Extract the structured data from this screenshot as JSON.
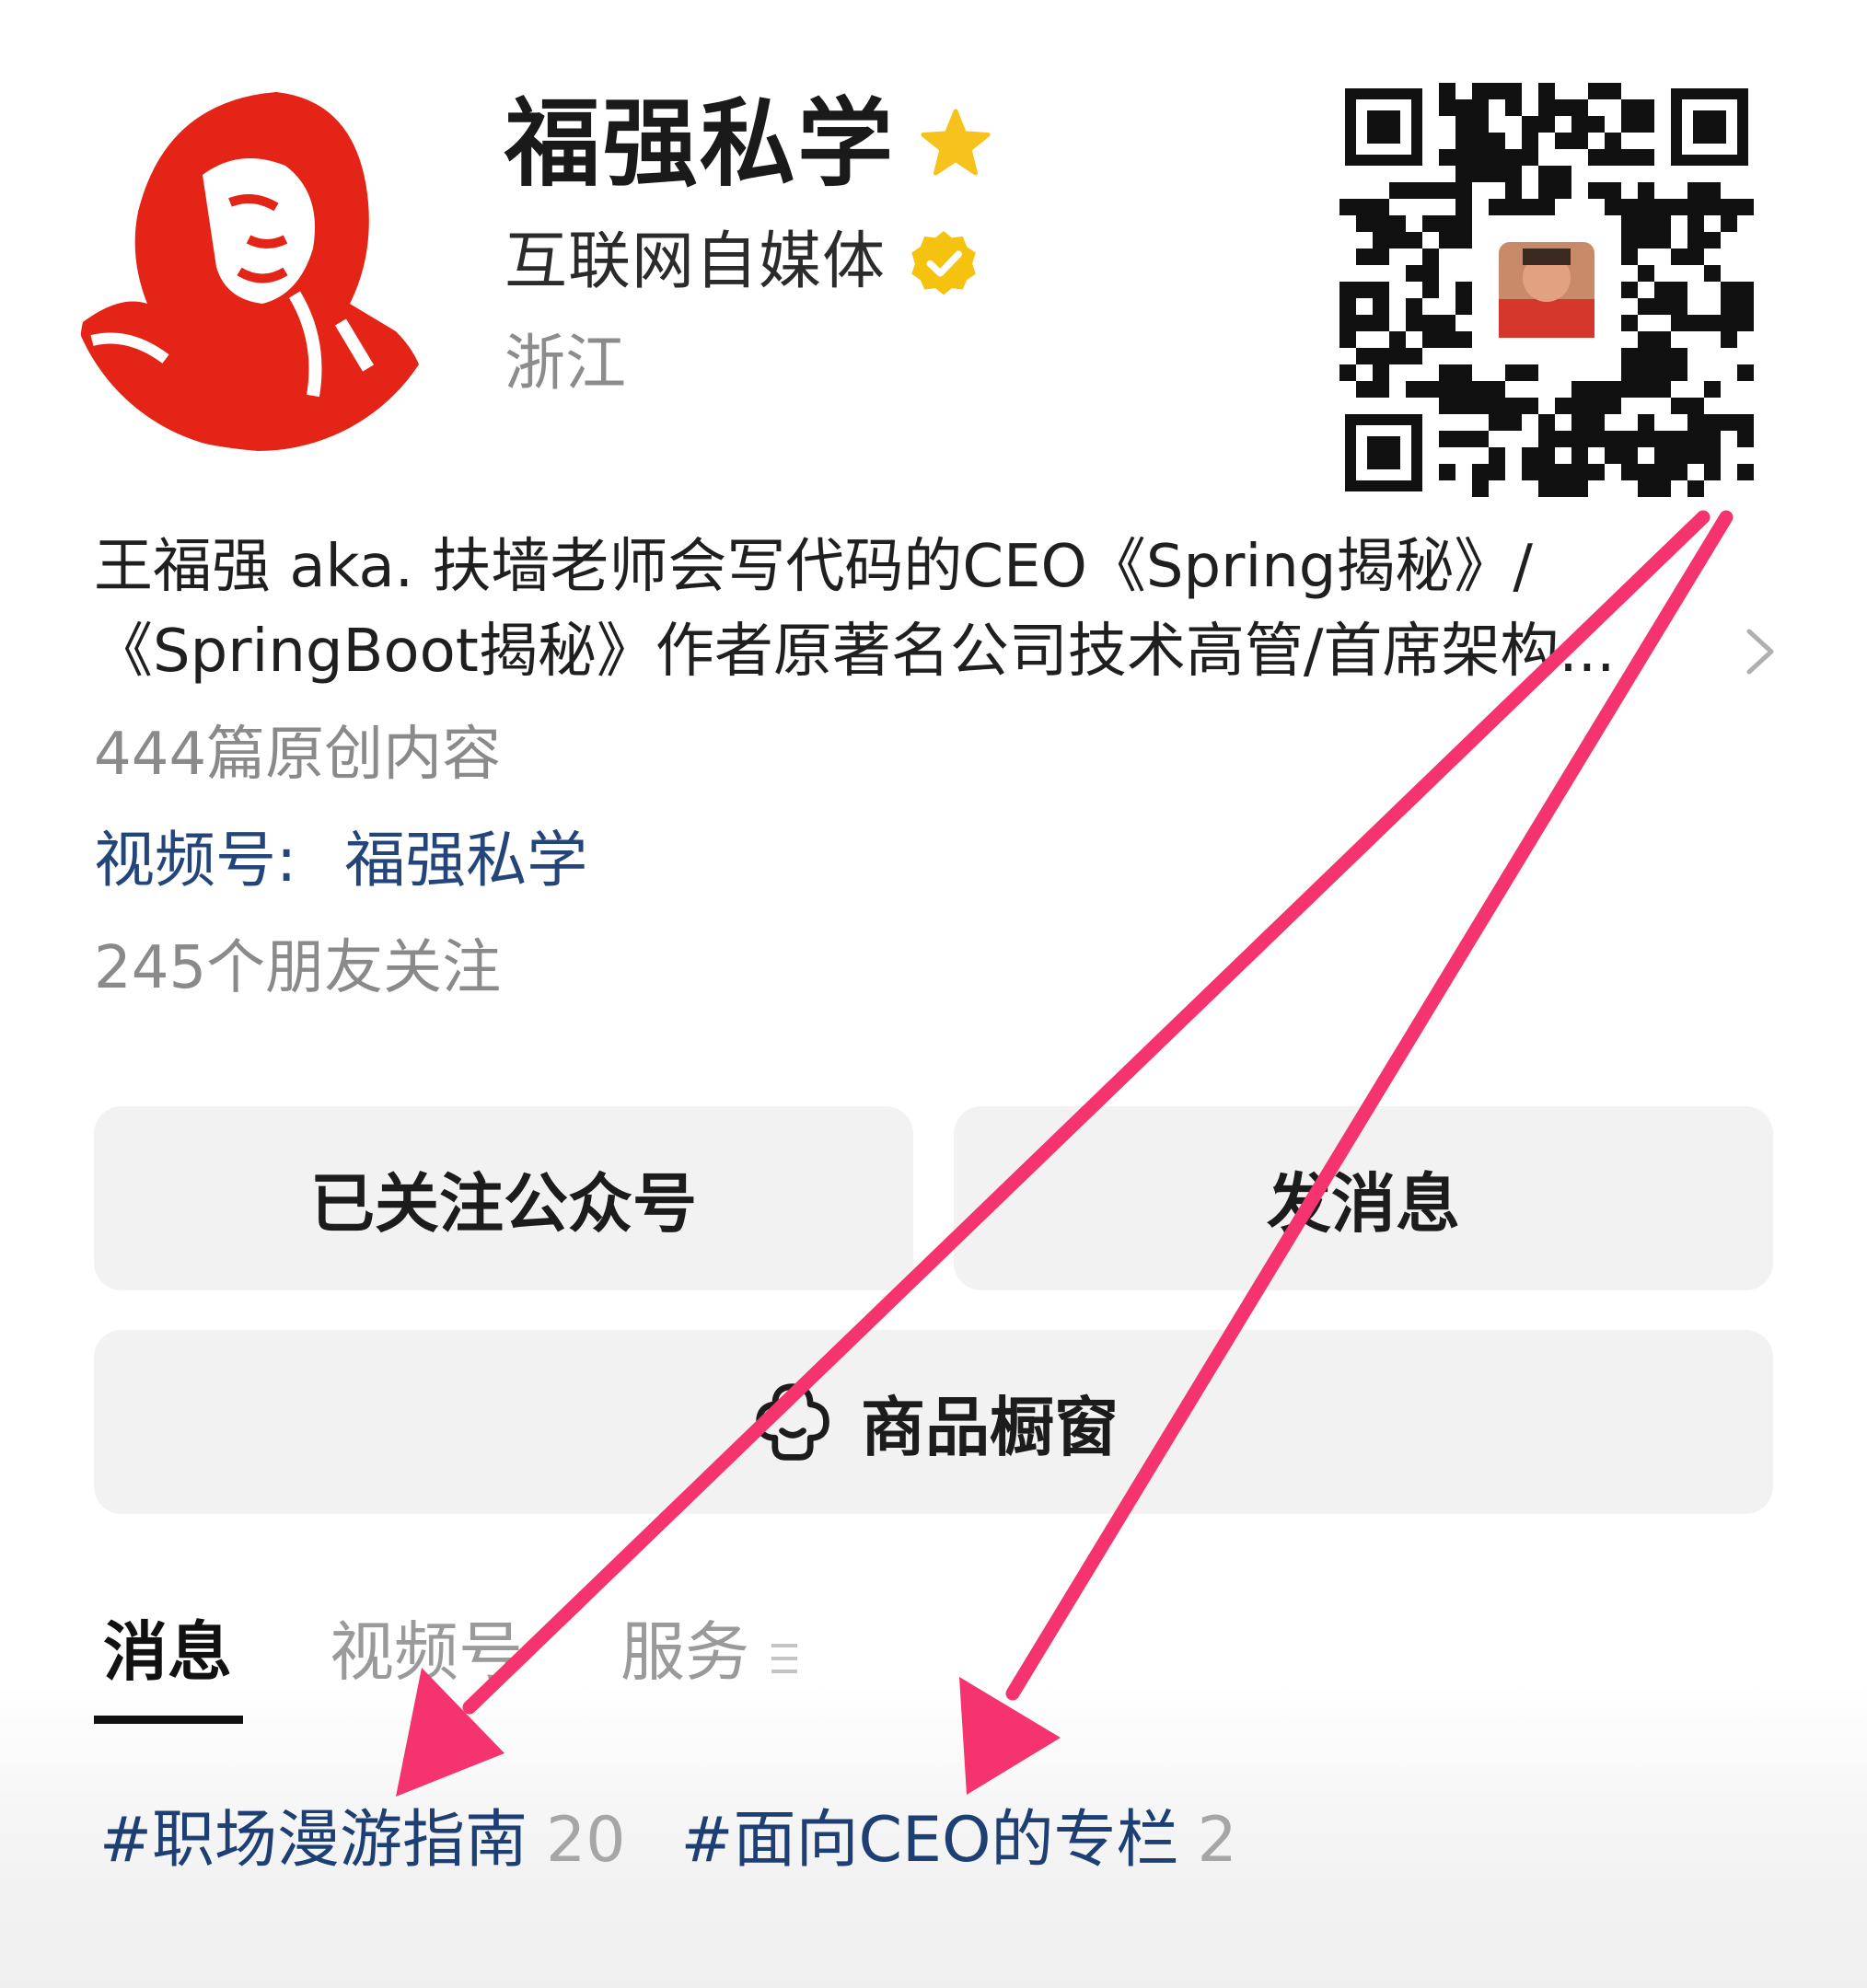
{
  "profile": {
    "name": "福强私学",
    "certification": "互联网自媒体",
    "region": "浙江",
    "intro_line1": "王福强 aka. 扶墙老师会写代码的CEO《Spring揭秘》/",
    "intro_line2": "《SpringBoot揭秘》作者原著名公司技术高管/首席架构...",
    "original_count": "444篇原创内容",
    "channels_label": "视频号:",
    "channels_value": "福强私学",
    "friends_follow": "245个朋友关注"
  },
  "actions": {
    "followed": "已关注公众号",
    "message": "发消息",
    "shop": "商品橱窗"
  },
  "tabs": [
    {
      "label": "消息",
      "active": true
    },
    {
      "label": "视频号",
      "active": false
    },
    {
      "label": "服务",
      "active": false
    }
  ],
  "tags": [
    {
      "label": "#职场漫游指南",
      "count": "20"
    },
    {
      "label": "#面向CEO的专栏",
      "count": "2"
    }
  ],
  "icons": {
    "name_badge": "star-icon",
    "cert_badge": "verified-icon",
    "intro_more": "chevron-right-icon",
    "shop": "shop-icon",
    "services_menu": "menu-icon"
  },
  "colors": {
    "star": "#f7c21b",
    "verified": "#f5c20f",
    "link": "#24457a",
    "annotation_arrow": "#f5336e",
    "avatar_red": "#e42416"
  }
}
